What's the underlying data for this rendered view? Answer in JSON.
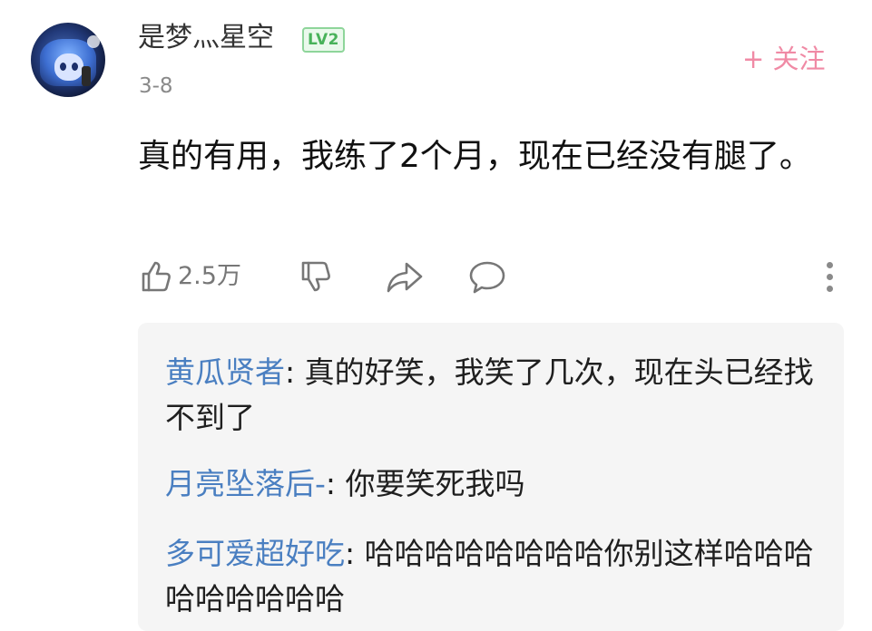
{
  "comment": {
    "username": "是梦灬星空",
    "level": "LV2",
    "date": "3-8",
    "follow_label": "+ 关注",
    "text": "真的有用，我练了2个月，现在已经没有腿了。",
    "avatar_icon": "anime-avatar",
    "actions": {
      "like_count": "2.5万",
      "like_icon": "thumb-up-icon",
      "dislike_icon": "thumb-down-icon",
      "share_icon": "share-icon",
      "reply_icon": "comment-icon",
      "more_icon": "more-vertical-icon"
    }
  },
  "replies": [
    {
      "author": "黄瓜贤者",
      "separator": ": ",
      "text": "真的好笑，我笑了几次，现在头已经找不到了"
    },
    {
      "author": "月亮坠落后-",
      "separator": ": ",
      "text": "你要笑死我吗"
    },
    {
      "author": "多可爱超好吃",
      "separator": ": ",
      "text": "哈哈哈哈哈哈哈哈你别这样哈哈哈哈哈哈哈哈哈"
    }
  ],
  "colors": {
    "accent_pink": "#f08aa5",
    "reply_author": "#4a7fc1",
    "level_green": "#48b25a"
  }
}
